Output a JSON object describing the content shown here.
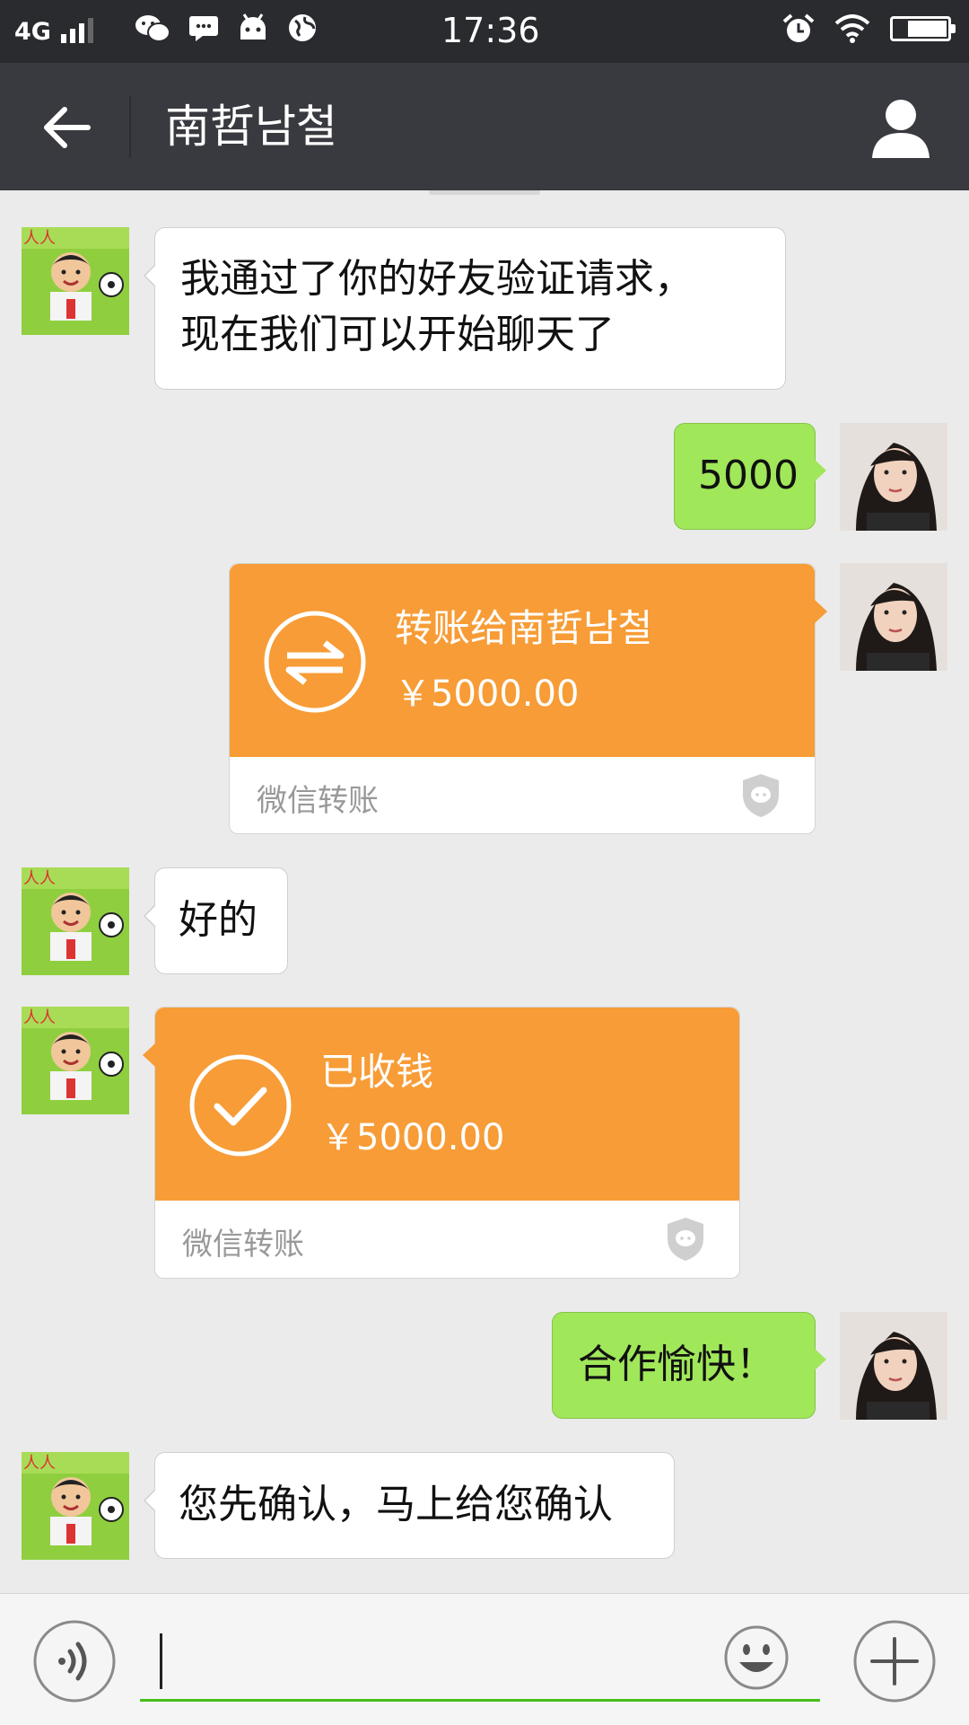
{
  "status_bar": {
    "network": "4G",
    "time": "17:36",
    "battery_level": 0.75
  },
  "header": {
    "title": "南哲남철"
  },
  "messages": [
    {
      "type": "text",
      "side": "in",
      "text_line1": "我通过了你的好友验证请求，",
      "text_line2": "现在我们可以开始聊天了"
    },
    {
      "type": "text",
      "side": "out",
      "text": "5000"
    },
    {
      "type": "transfer",
      "side": "out",
      "label": "转账给南哲남철",
      "amount": "￥5000.00",
      "footer": "微信转账",
      "icon": "transfer-arrows-icon"
    },
    {
      "type": "text",
      "side": "in",
      "text": "好的"
    },
    {
      "type": "transfer",
      "side": "in",
      "label": "已收钱",
      "amount": "￥5000.00",
      "footer": "微信转账",
      "icon": "checkmark-icon"
    },
    {
      "type": "text",
      "side": "out",
      "text": "合作愉快！"
    },
    {
      "type": "text",
      "side": "in",
      "text": "您先确认，马上给您确认"
    }
  ],
  "input_bar": {
    "value": "",
    "icons": [
      "voice-icon",
      "emoji-icon",
      "plus-icon"
    ]
  },
  "colors": {
    "titlebar": "#393a3f",
    "statusbar": "#2a2b2f",
    "chat_bg": "#ebebeb",
    "outgoing_bubble": "#a0e75a",
    "transfer_card": "#f79c36",
    "input_underline": "#45c01a"
  }
}
